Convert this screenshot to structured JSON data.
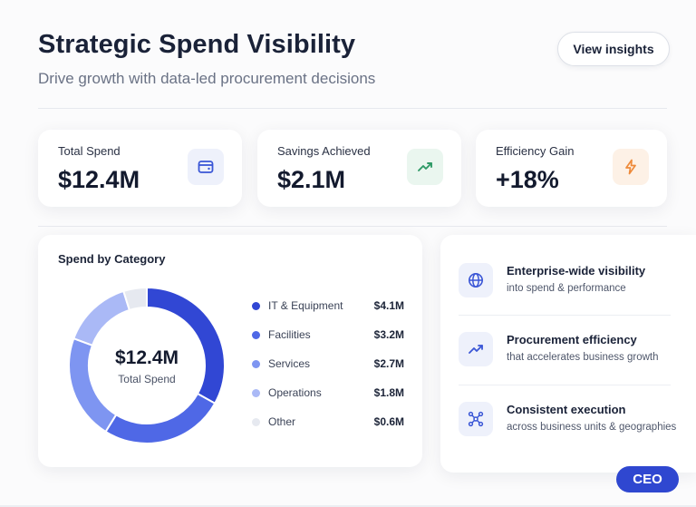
{
  "header": {
    "title": "Strategic Spend Visibility",
    "subtitle": "Drive growth with data-led procurement decisions",
    "insights_button": "View insights"
  },
  "kpis": [
    {
      "label": "Total Spend",
      "value": "$12.4M",
      "icon": "wallet-icon",
      "icon_color": "#3a56d6",
      "icon_bg": "#eef1fb"
    },
    {
      "label": "Savings Achieved",
      "value": "$2.1M",
      "icon": "trend-up-icon",
      "icon_color": "#2e9a66",
      "icon_bg": "#eaf6ef"
    },
    {
      "label": "Efficiency Gain",
      "value": "+18%",
      "icon": "lightning-icon",
      "icon_color": "#ee8a3a",
      "icon_bg": "#fdf1e6"
    }
  ],
  "category_card": {
    "title": "Spend by Category",
    "center_value": "$12.4M",
    "center_label": "Total Spend"
  },
  "chart_data": {
    "type": "pie",
    "title": "Spend by Category",
    "categories": [
      "IT & Equipment",
      "Facilities",
      "Services",
      "Operations",
      "Other"
    ],
    "values": [
      4.1,
      3.2,
      2.7,
      1.8,
      0.6
    ],
    "value_labels": [
      "$4.1M",
      "$3.2M",
      "$2.7M",
      "$1.8M",
      "$0.6M"
    ],
    "unit": "$M",
    "colors": [
      "#3147d4",
      "#4f68e6",
      "#7e95f1",
      "#aab9f6",
      "#e6e9f0"
    ],
    "legend_position": "right",
    "donut": true
  },
  "features": [
    {
      "title": "Enterprise-wide visibility",
      "subtitle": "into spend & performance",
      "icon": "globe-icon"
    },
    {
      "title": "Procurement efficiency",
      "subtitle": "that accelerates business growth",
      "icon": "trend-up-icon"
    },
    {
      "title": "Consistent execution",
      "subtitle": "across business units & geographies",
      "icon": "network-icon"
    }
  ],
  "badge": {
    "label": "CEO",
    "color": "#2f47d0"
  }
}
